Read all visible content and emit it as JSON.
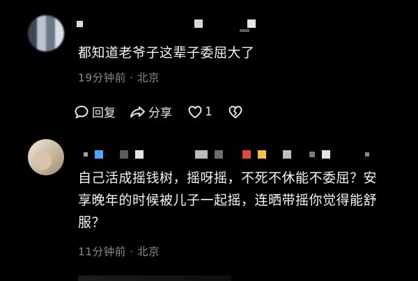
{
  "comments": [
    {
      "text": "都知道老爷子这辈子委屈大了",
      "meta": "19分钟前 · 北京",
      "actions": {
        "reply_label": "回复",
        "share_label": "分享",
        "like_count": "1"
      }
    },
    {
      "text_lines": [
        "自己活成摇钱树，摇呀摇，不死不休能不委屈？安",
        "享晚年的时候被儿子一起摇，连晒带摇你觉得能舒",
        "服？"
      ],
      "meta": "11分钟前 · 北京"
    }
  ],
  "icons": {
    "reply": "speech-bubble-icon",
    "share": "share-arrow-icon",
    "like": "heart-icon",
    "dislike": "broken-heart-icon"
  },
  "colors": {
    "background": "#000000",
    "text": "#f4f4f4",
    "meta": "#8b8b8b"
  }
}
